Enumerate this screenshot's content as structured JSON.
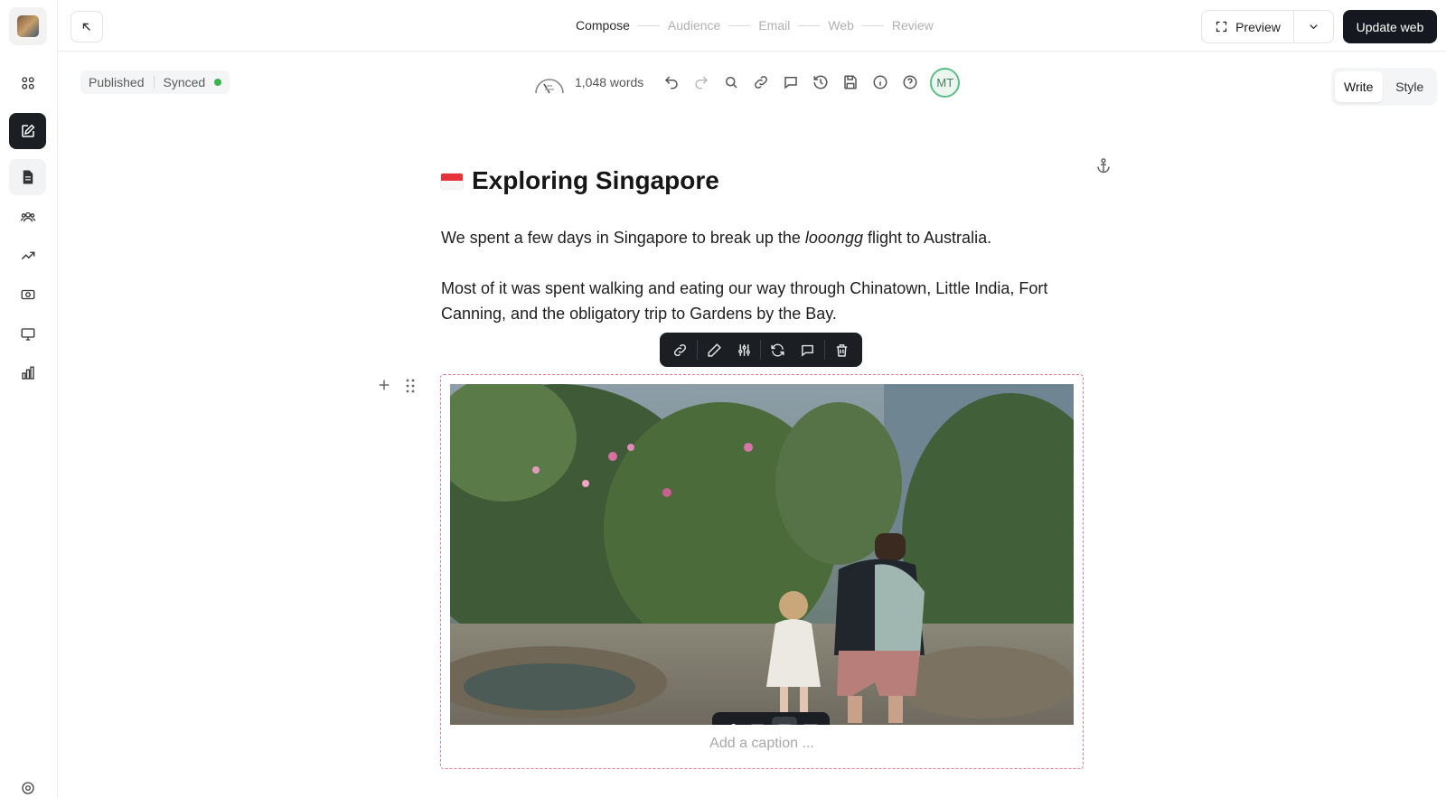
{
  "steps": [
    "Compose",
    "Audience",
    "Email",
    "Web",
    "Review"
  ],
  "header": {
    "preview_label": "Preview",
    "update_label": "Update web"
  },
  "status": {
    "published": "Published",
    "synced": "Synced",
    "synced_color": "#3bb54a"
  },
  "toolbar": {
    "word_count": "1,048 words",
    "avatar_initials": "MT",
    "icons": [
      "undo-icon",
      "redo-icon",
      "search-icon",
      "link-icon",
      "comment-icon",
      "history-icon",
      "save-icon",
      "info-icon",
      "help-icon"
    ]
  },
  "mode": {
    "write": "Write",
    "style": "Style",
    "active": "Write"
  },
  "post": {
    "title": "Exploring Singapore",
    "para1_before": "We spent a few days in Singapore to break up the ",
    "para1_em": "looongg",
    "para1_after": " flight to Australia.",
    "para2": "Most of it was spent walking and eating our way through Chinatown, Little India, Fort Canning, and the obligatory trip to Gardens by the Bay."
  },
  "image_block": {
    "caption_placeholder": "Add a caption ...",
    "toolbar_icons": [
      "link-icon",
      "edit-icon",
      "adjust-icon",
      "replace-icon",
      "comment-icon",
      "trash-icon"
    ],
    "width_options": [
      "link-icon",
      "regular-width-icon",
      "wide-width-icon",
      "full-width-icon"
    ],
    "selected_width": "wide-width-icon"
  },
  "sidebar": {
    "items": [
      "dashboard-icon",
      "compose-icon",
      "posts-icon",
      "audience-icon",
      "growth-icon",
      "monetization-icon",
      "website-icon",
      "analytics-icon",
      "settings-icon"
    ],
    "active": "compose-icon"
  }
}
